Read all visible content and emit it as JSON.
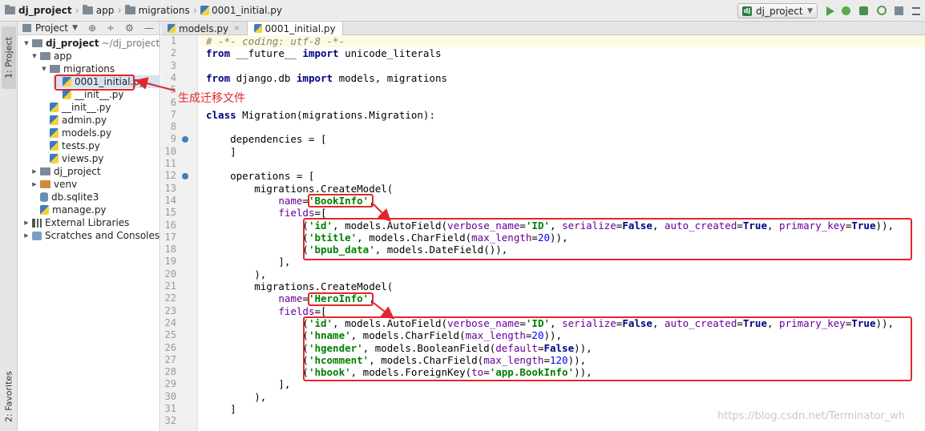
{
  "navbar": {
    "crumbs": [
      "dj_project",
      "app",
      "migrations",
      "0001_initial.py"
    ],
    "run_config": "dj_project"
  },
  "left_strip": {
    "project_tab": "1: Project",
    "favorites_tab": "2: Favorites"
  },
  "project_panel": {
    "title": "Project",
    "tree": [
      {
        "label": "dj_project",
        "suffix": "~/dj_project",
        "icon": "folder-icon",
        "depth": 0,
        "expanded": true
      },
      {
        "label": "app",
        "icon": "folder-icon",
        "depth": 1,
        "expanded": true
      },
      {
        "label": "migrations",
        "icon": "folder-icon",
        "depth": 2,
        "expanded": true
      },
      {
        "label": "0001_initial.py",
        "icon": "python-file-icon",
        "depth": 3,
        "selected": true
      },
      {
        "label": "__init__.py",
        "icon": "python-file-icon",
        "depth": 3
      },
      {
        "label": "__init__.py",
        "icon": "python-file-icon",
        "depth": 2
      },
      {
        "label": "admin.py",
        "icon": "python-file-icon",
        "depth": 2
      },
      {
        "label": "models.py",
        "icon": "python-file-icon",
        "depth": 2
      },
      {
        "label": "tests.py",
        "icon": "python-file-icon",
        "depth": 2
      },
      {
        "label": "views.py",
        "icon": "python-file-icon",
        "depth": 2
      },
      {
        "label": "dj_project",
        "icon": "folder-icon",
        "depth": 1,
        "expanded": false
      },
      {
        "label": "venv",
        "icon": "venv-folder-icon",
        "depth": 1,
        "expanded": false
      },
      {
        "label": "db.sqlite3",
        "icon": "database-icon",
        "depth": 1
      },
      {
        "label": "manage.py",
        "icon": "python-file-icon",
        "depth": 1
      },
      {
        "label": "External Libraries",
        "icon": "library-icon",
        "depth": 0,
        "expanded": false
      },
      {
        "label": "Scratches and Consoles",
        "icon": "scratches-icon",
        "depth": 0,
        "expanded": false
      }
    ]
  },
  "tabs": [
    {
      "label": "models.py",
      "active": false
    },
    {
      "label": "0001_initial.py",
      "active": true
    }
  ],
  "editor": {
    "line_numbers": [
      "1",
      "2",
      "3",
      "4",
      "5",
      "6",
      "7",
      "8",
      "9",
      "10",
      "11",
      "12",
      "13",
      "14",
      "15",
      "16",
      "17",
      "18",
      "19",
      "20",
      "21",
      "22",
      "23",
      "24",
      "25",
      "26",
      "27",
      "28",
      "29",
      "30",
      "31",
      "32"
    ]
  },
  "annotation": "生成迁移文件",
  "watermark": "https://blog.csdn.net/Terminator_wh",
  "colors": {
    "highlight": "#e3262b",
    "keyword": "#000080",
    "string": "#008000",
    "kwarg": "#660099",
    "comment": "#808080"
  }
}
